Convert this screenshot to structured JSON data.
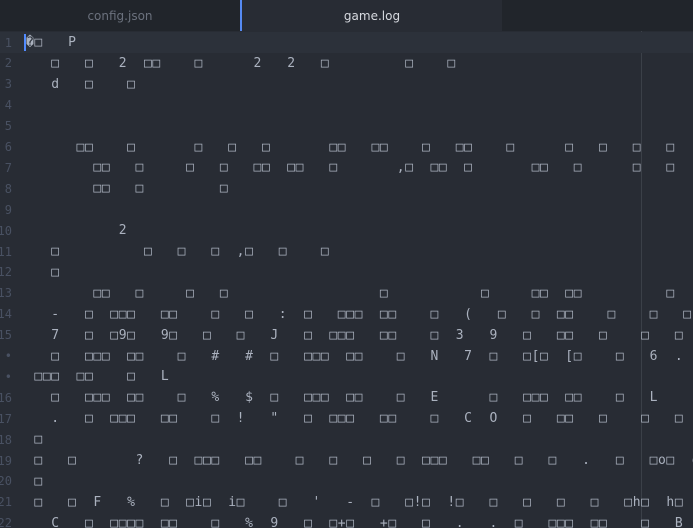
{
  "tabs": [
    {
      "label": "config.json",
      "active": false
    },
    {
      "label": "game.log",
      "active": true
    }
  ],
  "colors": {
    "accent": "#568af2",
    "background": "#282c34",
    "text": "#abb2bf"
  },
  "rows": [
    {
      "gutter": "1",
      "text": "�□   P"
    },
    {
      "gutter": "2",
      "text": "   □   □   2  □□    □      2   2   □         □    □"
    },
    {
      "gutter": "3",
      "text": "   d   □    □"
    },
    {
      "gutter": "4",
      "text": ""
    },
    {
      "gutter": "5",
      "text": ""
    },
    {
      "gutter": "6",
      "text": "      □□    □       □   □   □       □□   □□    □   □□    □      □   □   □   □"
    },
    {
      "gutter": "7",
      "text": "        □□   □     □   □   □□  □□   □       ,□  □□  □       □□   □      □   □"
    },
    {
      "gutter": "8",
      "text": "        □□   □         □"
    },
    {
      "gutter": "9",
      "text": ""
    },
    {
      "gutter": "10",
      "text": "           2"
    },
    {
      "gutter": "11",
      "text": "   □          □   □   □  ,□   □    □"
    },
    {
      "gutter": "12",
      "text": "   □"
    },
    {
      "gutter": "13",
      "text": "        □□   □     □   □                  □           □     □□  □□          □"
    },
    {
      "gutter": "14",
      "text": "   -   □  □□□   □□    □   □   :  □   □□□  □□    □   (   □   □  □□    □    □   □"
    },
    {
      "gutter": "15",
      "text": "   7   □  □9□   9□   □   □   J   □  □□□   □□    □  3   9   □   □□   □    □   □"
    },
    {
      "gutter": "•",
      "text": "   □   □□□  □□    □   #   #  □   □□□  □□    □   N   7  □   □[□  [□    □   6  ."
    },
    {
      "gutter": "•",
      "text": " □□□  □□    □   L"
    },
    {
      "gutter": "16",
      "text": "   □   □□□  □□    □   %   $  □   □□□  □□    □   E      □   □□□  □□    □   L"
    },
    {
      "gutter": "17",
      "text": "   .   □  □□□   □□    □  !   \"   □  □□□   □□    □   C  O   □   □□   □    □   □"
    },
    {
      "gutter": "18",
      "text": " □"
    },
    {
      "gutter": "19",
      "text": " □   □       ?   □  □□□   □□    □   □   □   □  □□□   □□   □   □   .   □   □o□  o"
    },
    {
      "gutter": "20",
      "text": " □"
    },
    {
      "gutter": "21",
      "text": " □   □  F   %   □  □i□  i□    □   '   -  □   □!□  !□   □   □   □   □   □h□  h□"
    },
    {
      "gutter": "22",
      "text": "   C   □  □□□□  □□    □   %  9   □  □+□   +□   □   .   .  □   □□□  □□    □   B"
    }
  ]
}
